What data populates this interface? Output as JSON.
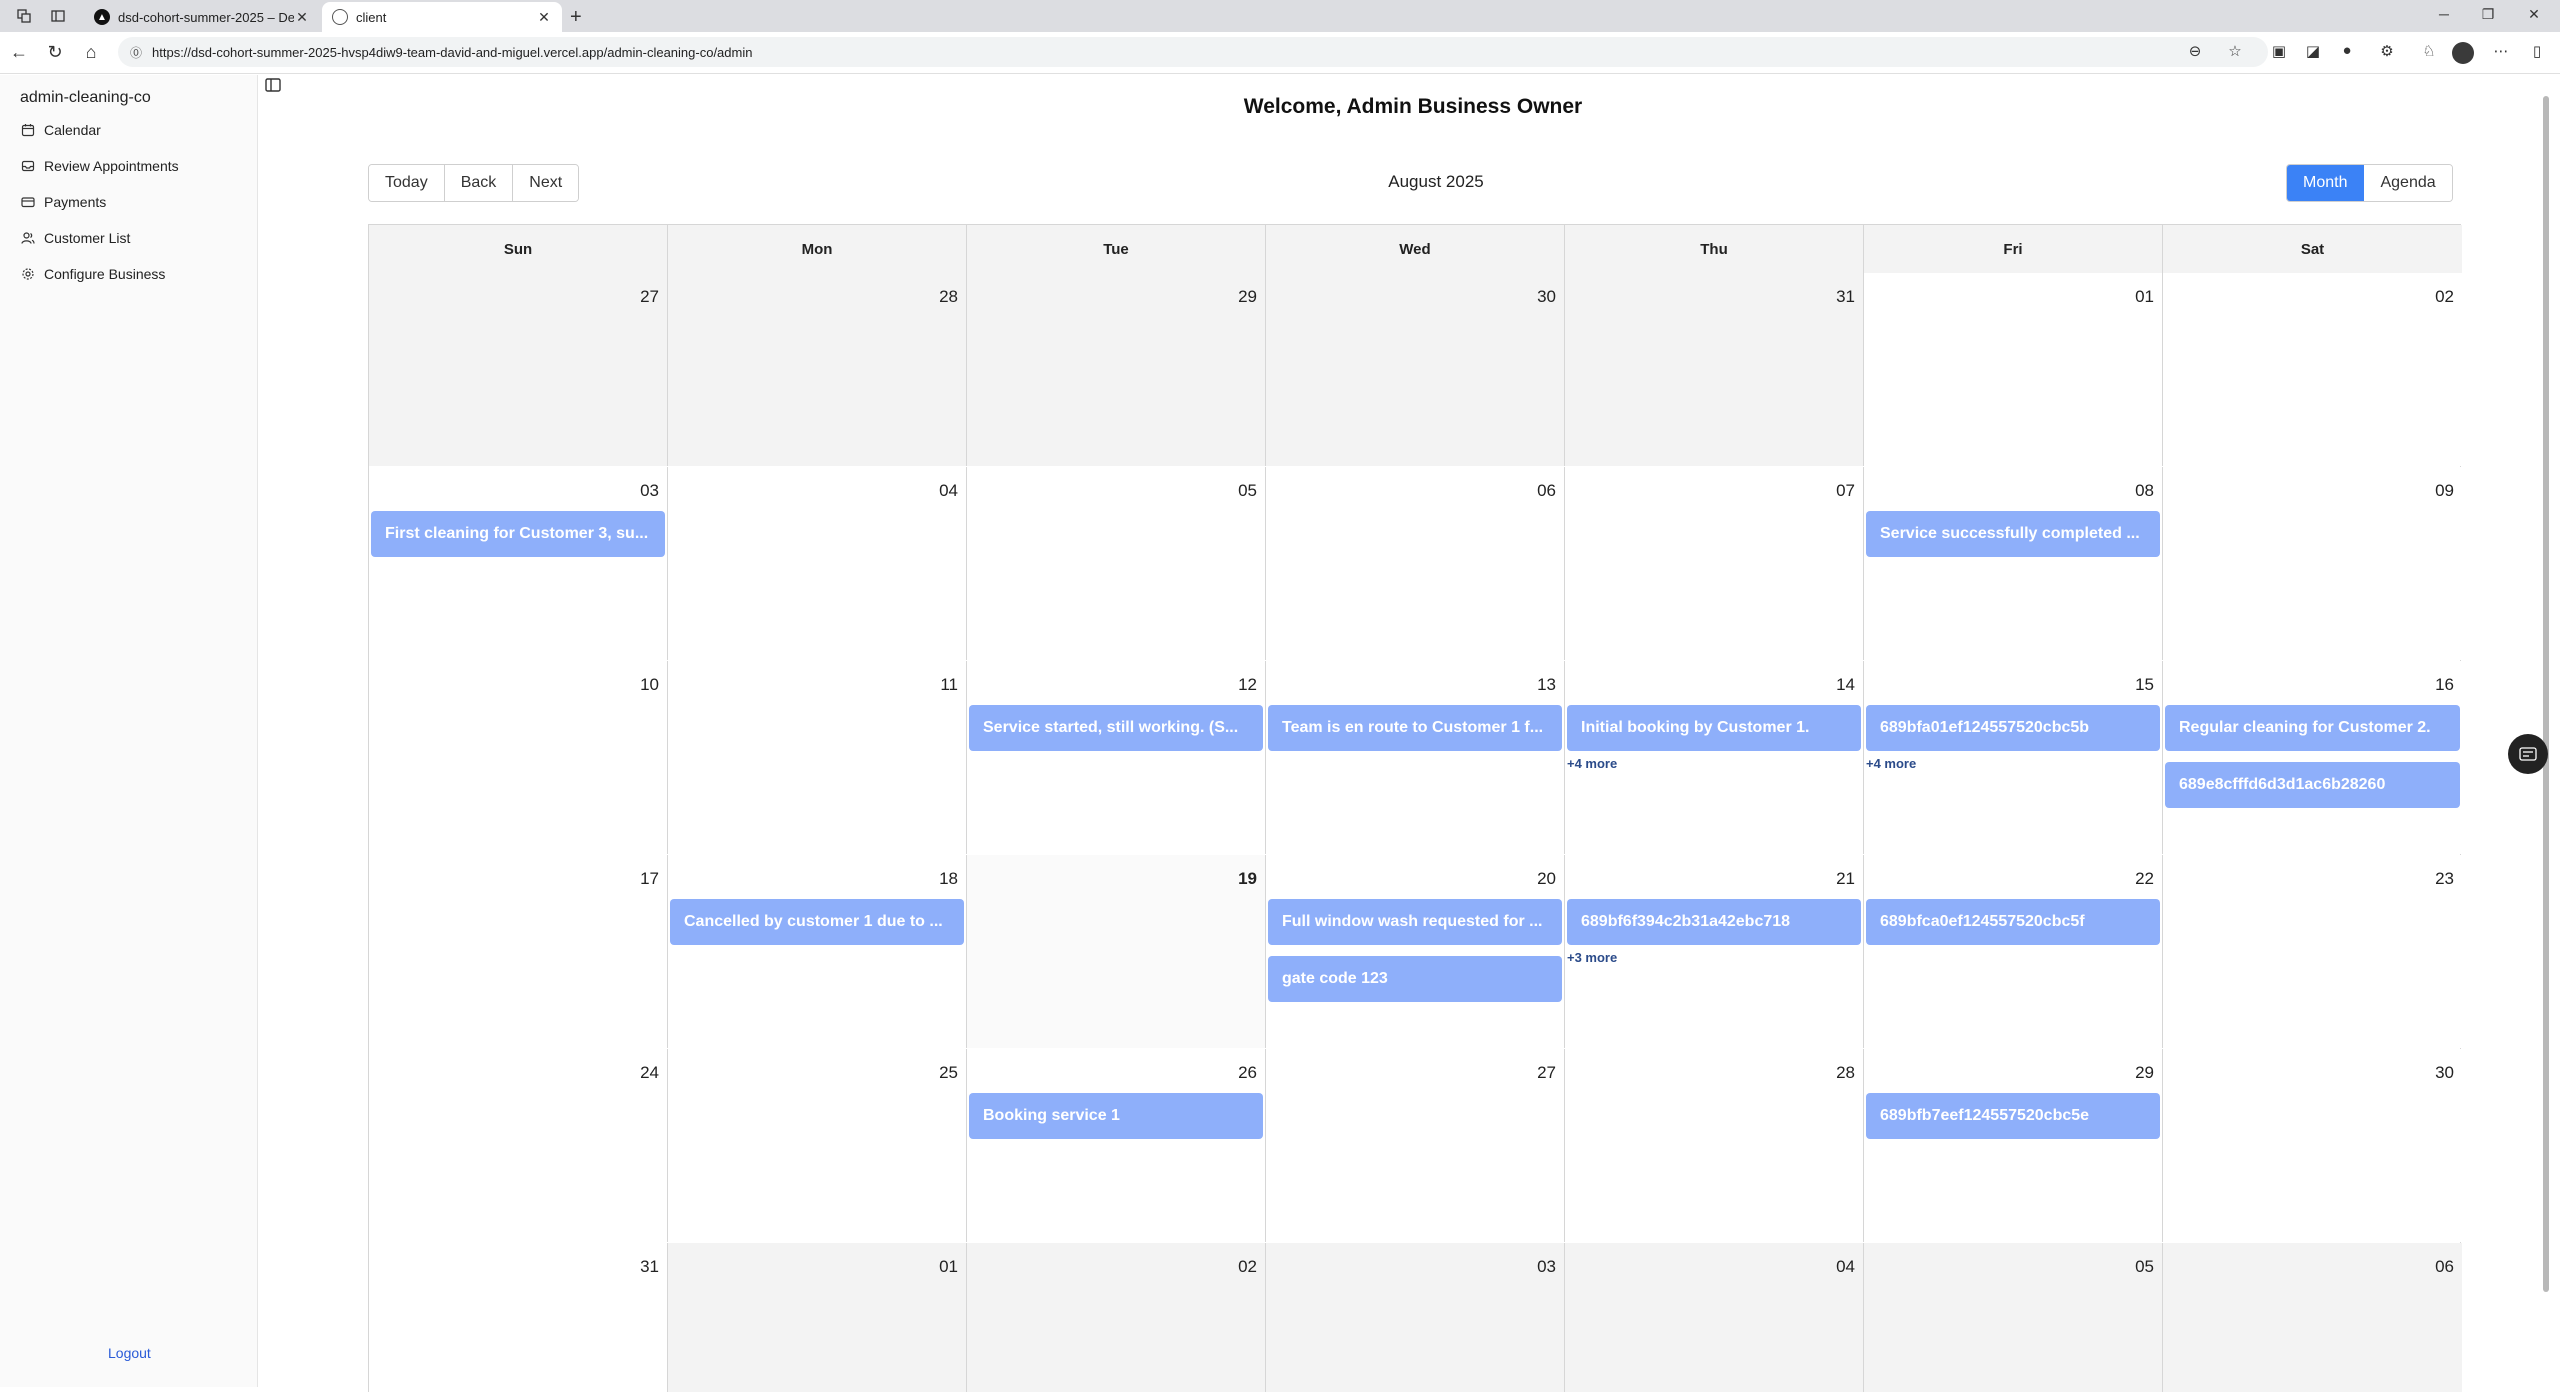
{
  "browser": {
    "tabs": [
      {
        "title": "dsd-cohort-summer-2025 – Depl"
      },
      {
        "title": "client"
      }
    ],
    "url": "https://dsd-cohort-summer-2025-hvsp4diw9-team-david-and-miguel.vercel.app/admin-cleaning-co/admin"
  },
  "sidebar": {
    "brand": "admin-cleaning-co",
    "items": [
      {
        "label": "Calendar",
        "icon": "calendar-icon"
      },
      {
        "label": "Review Appointments",
        "icon": "inbox-icon"
      },
      {
        "label": "Payments",
        "icon": "card-icon"
      },
      {
        "label": "Customer List",
        "icon": "users-icon"
      },
      {
        "label": "Configure Business",
        "icon": "gear-icon"
      }
    ],
    "logout": "Logout"
  },
  "main": {
    "welcome": "Welcome, Admin Business Owner",
    "toolbar": {
      "today": "Today",
      "back": "Back",
      "next": "Next",
      "label": "August 2025",
      "month": "Month",
      "agenda": "Agenda"
    },
    "weekdays": [
      "Sun",
      "Mon",
      "Tue",
      "Wed",
      "Thu",
      "Fri",
      "Sat"
    ],
    "weeks": [
      [
        {
          "day": "27",
          "off": true
        },
        {
          "day": "28",
          "off": true
        },
        {
          "day": "29",
          "off": true
        },
        {
          "day": "30",
          "off": true
        },
        {
          "day": "31",
          "off": true
        },
        {
          "day": "01"
        },
        {
          "day": "02"
        }
      ],
      [
        {
          "day": "03",
          "events": [
            "First cleaning for Customer 3, su..."
          ]
        },
        {
          "day": "04"
        },
        {
          "day": "05"
        },
        {
          "day": "06"
        },
        {
          "day": "07"
        },
        {
          "day": "08",
          "events": [
            "Service successfully completed ..."
          ]
        },
        {
          "day": "09"
        }
      ],
      [
        {
          "day": "10"
        },
        {
          "day": "11"
        },
        {
          "day": "12",
          "events": [
            "Service started, still working. (S..."
          ]
        },
        {
          "day": "13",
          "events": [
            "Team is en route to Customer 1 f..."
          ]
        },
        {
          "day": "14",
          "events": [
            "Initial booking by Customer 1."
          ],
          "more": "+4 more"
        },
        {
          "day": "15",
          "events": [
            "689bfa01ef124557520cbc5b"
          ],
          "more": "+4 more"
        },
        {
          "day": "16",
          "events": [
            "Regular cleaning for Customer 2.",
            "689e8cfffd6d3d1ac6b28260"
          ]
        }
      ],
      [
        {
          "day": "17"
        },
        {
          "day": "18",
          "events": [
            "Cancelled by customer 1 due to ..."
          ]
        },
        {
          "day": "19",
          "today": true
        },
        {
          "day": "20",
          "events": [
            "Full window wash requested for ...",
            "gate code 123"
          ]
        },
        {
          "day": "21",
          "events": [
            "689bf6f394c2b31a42ebc718"
          ],
          "more": "+3 more"
        },
        {
          "day": "22",
          "events": [
            "689bfca0ef124557520cbc5f"
          ]
        },
        {
          "day": "23"
        }
      ],
      [
        {
          "day": "24"
        },
        {
          "day": "25"
        },
        {
          "day": "26",
          "events": [
            "Booking service 1"
          ]
        },
        {
          "day": "27"
        },
        {
          "day": "28"
        },
        {
          "day": "29",
          "events": [
            "689bfb7eef124557520cbc5e"
          ]
        },
        {
          "day": "30"
        }
      ],
      [
        {
          "day": "31"
        },
        {
          "day": "01",
          "off": true
        },
        {
          "day": "02",
          "off": true
        },
        {
          "day": "03",
          "off": true
        },
        {
          "day": "04",
          "off": true
        },
        {
          "day": "05",
          "off": true
        },
        {
          "day": "06",
          "off": true
        }
      ]
    ]
  },
  "colors": {
    "accent": "#3b82f6",
    "event": "#8eaffa",
    "more_link": "#2b4b8a"
  }
}
